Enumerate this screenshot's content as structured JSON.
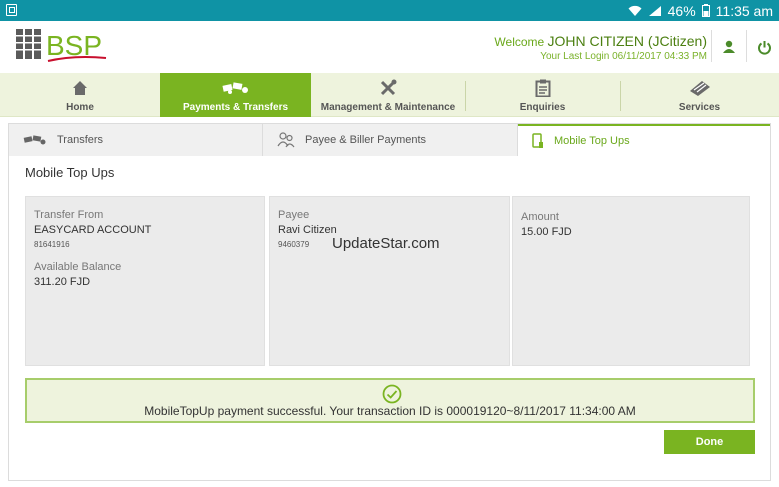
{
  "status_bar": {
    "battery_percent": "46%",
    "time": "11:35 am"
  },
  "header": {
    "logo_text": "BSP",
    "welcome_label": "Welcome",
    "user_name": "JOHN CITIZEN (JCitizen)",
    "last_login": "Your Last Login 06/11/2017 04:33 PM"
  },
  "main_nav": [
    {
      "label": "Home",
      "icon": "home-icon"
    },
    {
      "label": "Payments & Transfers",
      "icon": "money-icon",
      "active": true
    },
    {
      "label": "Management & Maintenance",
      "icon": "tools-icon"
    },
    {
      "label": "Enquiries",
      "icon": "clipboard-icon"
    },
    {
      "label": "Services",
      "icon": "services-icon"
    }
  ],
  "sub_tabs": [
    {
      "label": "Transfers",
      "icon": "money-icon"
    },
    {
      "label": "Payee & Biller Payments",
      "icon": "people-icon"
    },
    {
      "label": "Mobile Top Ups",
      "icon": "phone-icon",
      "active": true
    }
  ],
  "page_title": "Mobile Top Ups",
  "transfer_from": {
    "label": "Transfer From",
    "account_name": "EASYCARD ACCOUNT",
    "account_number": "81641916",
    "balance_label": "Available Balance",
    "balance_value": "311.20 FJD"
  },
  "payee": {
    "label": "Payee",
    "name": "Ravi Citizen",
    "number": "9460379"
  },
  "amount": {
    "label": "Amount",
    "value": "15.00 FJD"
  },
  "watermark": "UpdateStar.com",
  "success_message": "MobileTopUp payment successful. Your transaction ID is 000019120~8/11/2017 11:34:00 AM",
  "done_label": "Done",
  "colors": {
    "status_bar": "#0f93a5",
    "accent_green": "#7ab421",
    "nav_bg": "#eef3dd",
    "logo_red": "#c8102e"
  }
}
